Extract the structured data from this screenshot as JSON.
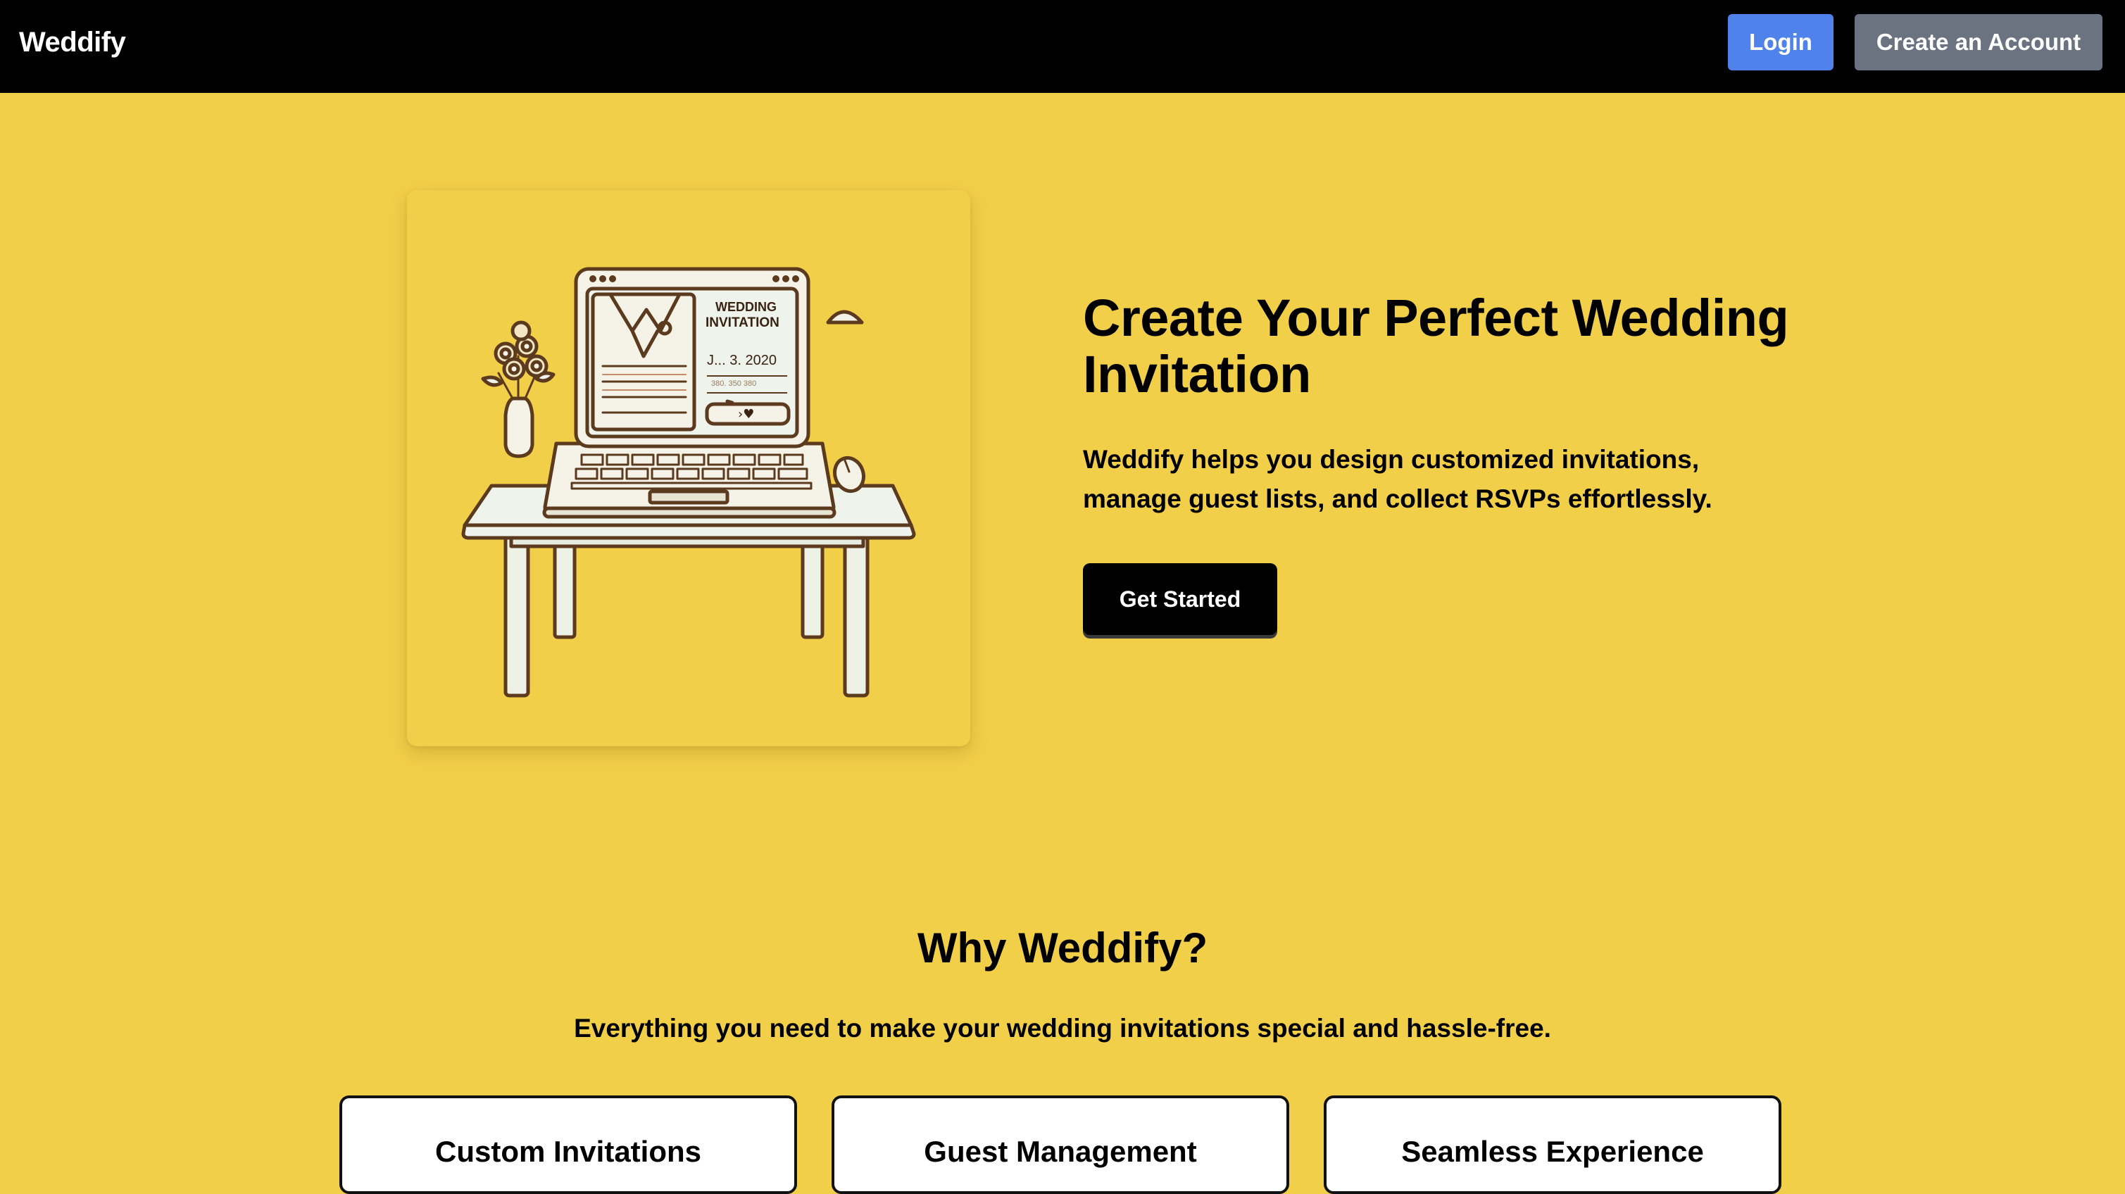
{
  "nav": {
    "brand": "Weddify",
    "login_label": "Login",
    "create_account_label": "Create an Account"
  },
  "hero": {
    "title": "Create Your Perfect Wedding Invitation",
    "description": "Weddify helps you design customized invitations, manage guest lists, and collect RSVPs effortlessly.",
    "cta_label": "Get Started",
    "illustration": {
      "screen_heading_1": "WEDDING",
      "screen_heading_2": "INVITATION",
      "screen_date": "J... 3. 2020",
      "screen_small_text": "380. 350 380",
      "screen_button": "›♥"
    }
  },
  "why": {
    "title": "Why Weddify?",
    "subtitle": "Everything you need to make your wedding invitations special and hassle-free.",
    "features": [
      {
        "title": "Custom Invitations"
      },
      {
        "title": "Guest Management"
      },
      {
        "title": "Seamless Experience"
      }
    ]
  },
  "colors": {
    "background": "#f2cf49",
    "nav": "#000000",
    "login": "#4f82ea",
    "create_account": "#6b7280",
    "cta": "#000000"
  }
}
